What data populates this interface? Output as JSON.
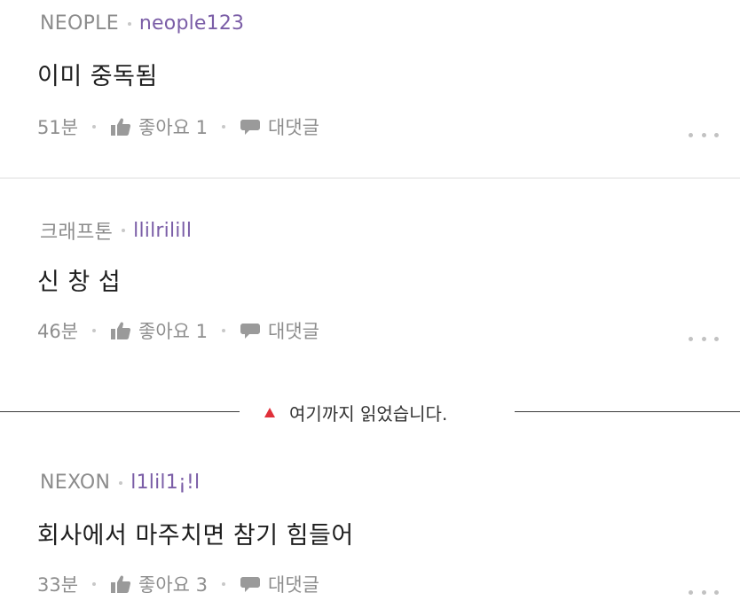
{
  "comments": [
    {
      "company": "NEOPLE",
      "nickname": "neople123",
      "text": "이미 중독됨",
      "time": "51분",
      "like_label": "좋아요 1",
      "reply_label": "대댓글"
    },
    {
      "company": "크래프톤",
      "nickname": "llilrilill",
      "text": "신 창 섭",
      "time": "46분",
      "like_label": "좋아요 1",
      "reply_label": "대댓글"
    },
    {
      "company": "NEXON",
      "nickname": "l1lil1¡!l",
      "text": "회사에서 마주치면 참기 힘들어",
      "time": "33분",
      "like_label": "좋아요 3",
      "reply_label": "대댓글"
    }
  ],
  "read_marker": {
    "label": "여기까지 읽었습니다."
  },
  "colors": {
    "nickname": "#7b5ea7",
    "marker_triangle": "#e0303a",
    "muted_text": "#8e8e8e"
  },
  "icons": {
    "like": "thumbs-up-icon",
    "reply": "speech-bubble-icon",
    "more": "more-dots-icon",
    "marker": "red-triangle-icon"
  }
}
